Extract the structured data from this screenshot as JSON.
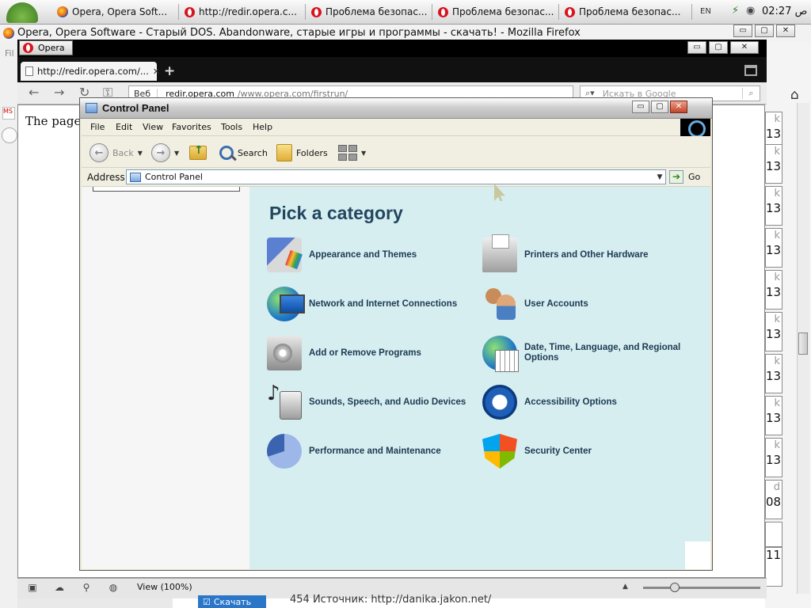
{
  "taskbar": {
    "tasks": [
      {
        "label": "Opera, Opera Soft...",
        "icon": "firefox-icon"
      },
      {
        "label": "http://redir.opera.c...",
        "icon": "opera-icon"
      },
      {
        "label": "Проблема безопас...",
        "icon": "opera-icon"
      },
      {
        "label": "Проблема безопас...",
        "icon": "opera-icon"
      },
      {
        "label": "Проблема безопас...",
        "icon": "opera-icon"
      }
    ],
    "lang": "EN",
    "clock": "02:27 ص"
  },
  "firefox": {
    "title": "Opera, Opera Software - Старый DOS. Abandonware, старые игры и программы - скачать! - Mozilla Firefox",
    "controls": {
      "minimize": "▭",
      "maximize": "▢",
      "close": "✕"
    },
    "left_strip": {
      "file_menu": "Fil",
      "ms_badge": "MS"
    },
    "right_cells": [
      {
        "k": "k",
        "v": "13"
      },
      {
        "k": "k",
        "v": "13"
      },
      {
        "k": "k",
        "v": "13"
      },
      {
        "k": "k",
        "v": "13"
      },
      {
        "k": "k",
        "v": "13"
      },
      {
        "k": "k",
        "v": "13"
      },
      {
        "k": "k",
        "v": "13"
      },
      {
        "k": "k",
        "v": "13"
      },
      {
        "k": "k",
        "v": "13"
      },
      {
        "k": "d",
        "v": "08"
      },
      {
        "k": "",
        "v": ""
      },
      {
        "k": "",
        "v": "11"
      }
    ],
    "bottom": {
      "download_label": "Скачать",
      "source_text": "454 Источник: http://danika.jakon.net/"
    }
  },
  "opera": {
    "menu_label": "Opera",
    "tab_label": "http://redir.opera.com/...",
    "tab_close": "✕",
    "new_tab": "+",
    "url": {
      "prefix": "Веб",
      "host": "redir.opera.com",
      "path": "/www.opera.com/firstrun/"
    },
    "search_placeholder": "Искать в Google",
    "page_text": "The page y",
    "zoom_label": "View (100%)",
    "zoom_level": 0.27
  },
  "control_panel": {
    "title": "Control Panel",
    "controls": {
      "minimize": "▭",
      "maximize": "▢",
      "close": "✕"
    },
    "menu": [
      "File",
      "Edit",
      "View",
      "Favorites",
      "Tools",
      "Help"
    ],
    "toolbar": {
      "back": "Back",
      "search": "Search",
      "folders": "Folders"
    },
    "address": {
      "label": "Address",
      "value": "Control Panel",
      "go": "Go"
    },
    "heading": "Pick a category",
    "categories": [
      {
        "label": "Appearance and Themes",
        "icon": "appearance-themes-icon"
      },
      {
        "label": "Printers and Other Hardware",
        "icon": "printer-icon"
      },
      {
        "label": "Network and Internet Connections",
        "icon": "network-icon"
      },
      {
        "label": "User Accounts",
        "icon": "user-accounts-icon"
      },
      {
        "label": "Add or Remove Programs",
        "icon": "add-remove-programs-icon"
      },
      {
        "label": "Date, Time, Language, and Regional Options",
        "icon": "date-time-globe-icon"
      },
      {
        "label": "Sounds, Speech, and Audio Devices",
        "icon": "sounds-speaker-icon"
      },
      {
        "label": "Accessibility Options",
        "icon": "accessibility-icon"
      },
      {
        "label": "Performance and Maintenance",
        "icon": "performance-icon"
      },
      {
        "label": "Security Center",
        "icon": "security-shield-icon"
      }
    ]
  }
}
